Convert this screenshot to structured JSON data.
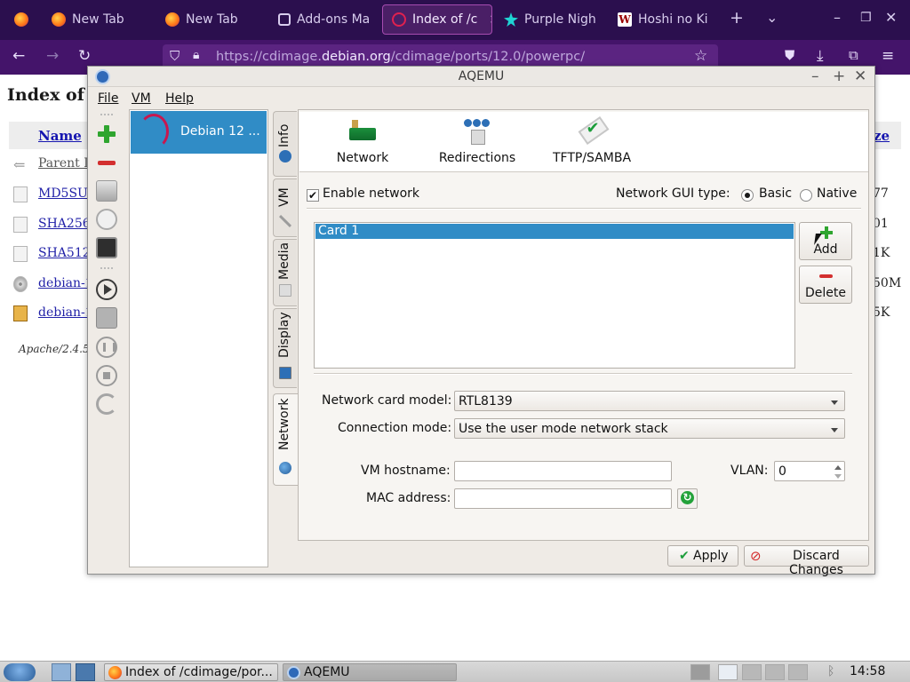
{
  "browser": {
    "tabs": [
      {
        "label": "",
        "icon": "firefox-icon",
        "active": false
      },
      {
        "label": "New Tab",
        "icon": "firefox-icon",
        "active": false
      },
      {
        "label": "New Tab",
        "icon": "firefox-icon",
        "active": false
      },
      {
        "label": "Add-ons Ma",
        "icon": "puzzle-icon",
        "active": false
      },
      {
        "label": "Index of /c",
        "icon": "debian-icon",
        "active": true
      },
      {
        "label": "Purple Nigh",
        "icon": "star-icon",
        "active": false
      },
      {
        "label": "Hoshi no Ki",
        "icon": "wikipedia-icon",
        "active": false
      }
    ],
    "url_prefix": "https://cdimage.",
    "url_domain": "debian.org",
    "url_path": "/cdimage/ports/12.0/powerpc/"
  },
  "webpage": {
    "title": "Index of /c",
    "col_name": "Name",
    "col_size": "ze",
    "rows": [
      {
        "name": "Parent D",
        "size": "",
        "icon": "back-icon"
      },
      {
        "name": "MD5SU",
        "size": "77",
        "icon": "file-icon"
      },
      {
        "name": "SHA256",
        "size": "01",
        "icon": "file-icon"
      },
      {
        "name": "SHA512",
        "size": "1K",
        "icon": "file-icon"
      },
      {
        "name": "debian-1",
        "size": "50M",
        "icon": "disc-icon"
      },
      {
        "name": "debian-1",
        "size": "5K",
        "icon": "package-icon"
      }
    ],
    "footer": "Apache/2.4.58"
  },
  "aqemu": {
    "title": "AQEMU",
    "menu": {
      "file": "File",
      "vm": "VM",
      "help": "Help"
    },
    "vm_name": "Debian 12 ...",
    "side_tabs": {
      "info": "Info",
      "vm": "VM",
      "media": "Media",
      "display": "Display",
      "network": "Network"
    },
    "sub_tabs": {
      "network": "Network",
      "redirections": "Redirections",
      "tftp": "TFTP/SAMBA"
    },
    "enable_network": "Enable network",
    "gui_type_label": "Network GUI type:",
    "gui_basic": "Basic",
    "gui_native": "Native",
    "cards": [
      "Card 1"
    ],
    "add_label": "Add",
    "delete_label": "Delete",
    "card_model_label": "Network card model:",
    "card_model_value": "RTL8139",
    "connection_label": "Connection mode:",
    "connection_value": "Use the user mode network stack",
    "hostname_label": "VM hostname:",
    "hostname_value": "",
    "vlan_label": "VLAN:",
    "vlan_value": "0",
    "mac_label": "MAC address:",
    "mac_value": "",
    "apply_label": "Apply",
    "discard_label": "Discard Changes"
  },
  "taskbar": {
    "task_browser": "Index of /cdimage/por...",
    "task_aqemu": "AQEMU",
    "clock": "14:58"
  },
  "colors": {
    "firefox_tabbar": "#2b0f4e",
    "selection": "#308cc6",
    "link": "#1515b0"
  }
}
